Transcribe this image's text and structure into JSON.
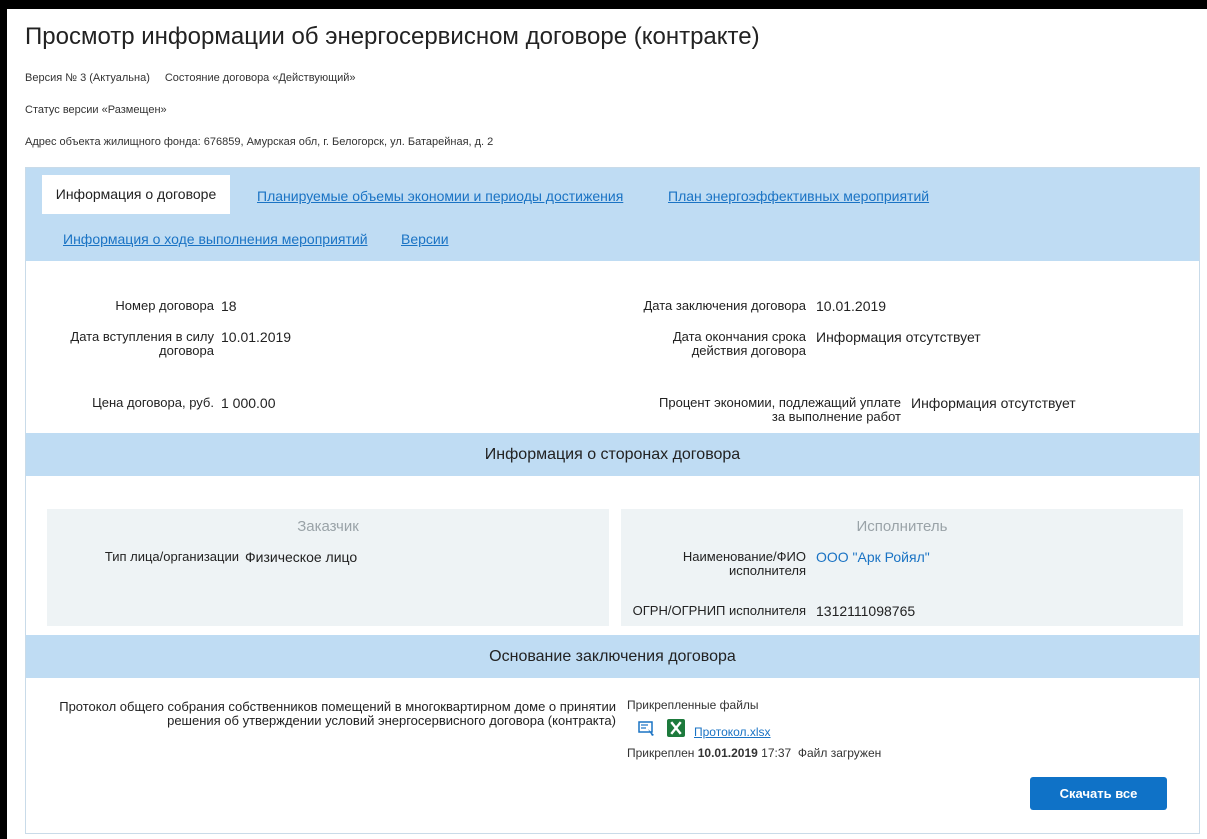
{
  "page": {
    "title": "Просмотр информации об энергосервисном договоре (контракте)",
    "version": "Версия № 3 (Актуальна)",
    "contract_state": "Состояние договора «Действующий»",
    "version_status": "Статус версии «Размещен»",
    "address": "Адрес объекта жилищного фонда: 676859, Амурская обл, г. Белогорск, ул. Батарейная, д. 2"
  },
  "tabs": {
    "active": "Информация о договоре",
    "t2": "Планируемые объемы экономии и периоды достижения",
    "t3": "План энергоэффективных мероприятий",
    "t4": "Информация о ходе выполнения мероприятий",
    "t5": "Версии"
  },
  "fields": {
    "number_label": "Номер договора",
    "number_value": "18",
    "conclusion_date_label": "Дата заключения договора",
    "conclusion_date_value": "10.01.2019",
    "effective_date_label": "Дата вступления в силу договора",
    "effective_date_value": "10.01.2019",
    "end_date_label": "Дата окончания срока действия договора",
    "end_date_value": "Информация отсутствует",
    "price_label": "Цена договора, руб.",
    "price_value": "1 000.00",
    "percent_label": "Процент экономии, подлежащий уплате за выполнение работ",
    "percent_value": "Информация отсутствует"
  },
  "parties": {
    "heading": "Информация о сторонах договора",
    "customer_title": "Заказчик",
    "customer_type_label": "Тип лица/организации",
    "customer_type_value": "Физическое лицо",
    "contractor_title": "Исполнитель",
    "contractor_name_label": "Наименование/ФИО исполнителя",
    "contractor_name_value": "ООО \"Арк Ройял\"",
    "contractor_ogrn_label": "ОГРН/ОГРНИП исполнителя",
    "contractor_ogrn_value": "1312111098765"
  },
  "basis": {
    "heading": "Основание заключения договора",
    "protocol_label": "Протокол общего собрания собственников помещений в многоквартирном доме о принятии решения об утверждении условий энергосервисного договора (контракта)",
    "attached_files_label": "Прикрепленные файлы",
    "file_name": "Протокол.xlsx",
    "attached_prefix": "Прикреплен",
    "attached_date": "10.01.2019",
    "attached_time": "17:37",
    "file_status": "Файл загружен",
    "download_all": "Скачать все"
  },
  "icons": {
    "signature": "signature-icon",
    "excel": "excel-file-icon"
  },
  "colors": {
    "band": "#bfdcf3",
    "link": "#1a73c4",
    "button": "#0f72c7",
    "excel": "#1d7a3c"
  }
}
